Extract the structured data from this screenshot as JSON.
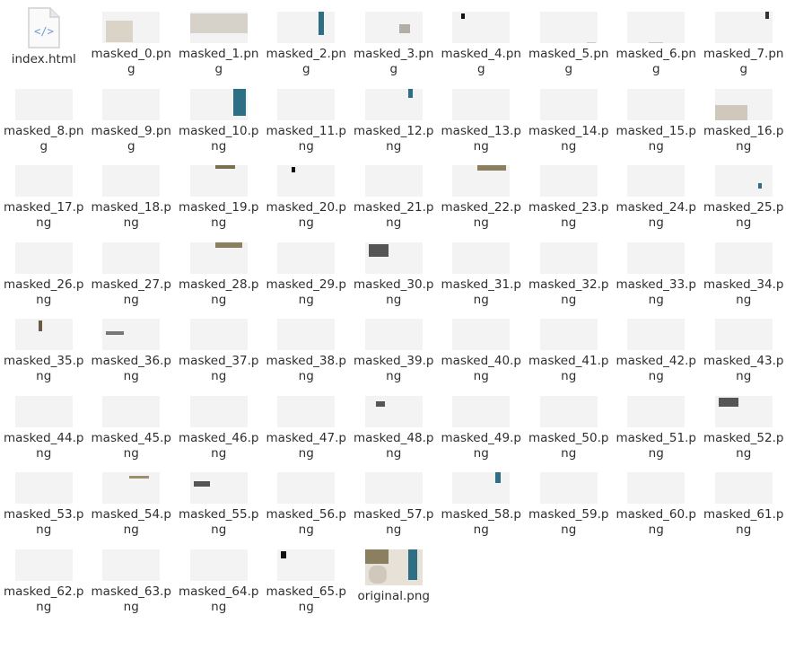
{
  "files": [
    {
      "name": "index.html",
      "type": "html",
      "icon": "html-file-icon"
    },
    {
      "name": "masked_0.png",
      "type": "png"
    },
    {
      "name": "masked_1.png",
      "type": "png"
    },
    {
      "name": "masked_2.png",
      "type": "png"
    },
    {
      "name": "masked_3.png",
      "type": "png"
    },
    {
      "name": "masked_4.png",
      "type": "png"
    },
    {
      "name": "masked_5.png",
      "type": "png"
    },
    {
      "name": "masked_6.png",
      "type": "png"
    },
    {
      "name": "masked_7.png",
      "type": "png"
    },
    {
      "name": "masked_8.png",
      "type": "png"
    },
    {
      "name": "masked_9.png",
      "type": "png"
    },
    {
      "name": "masked_10.png",
      "type": "png"
    },
    {
      "name": "masked_11.png",
      "type": "png"
    },
    {
      "name": "masked_12.png",
      "type": "png"
    },
    {
      "name": "masked_13.png",
      "type": "png"
    },
    {
      "name": "masked_14.png",
      "type": "png"
    },
    {
      "name": "masked_15.png",
      "type": "png"
    },
    {
      "name": "masked_16.png",
      "type": "png"
    },
    {
      "name": "masked_17.png",
      "type": "png"
    },
    {
      "name": "masked_18.png",
      "type": "png"
    },
    {
      "name": "masked_19.png",
      "type": "png"
    },
    {
      "name": "masked_20.png",
      "type": "png"
    },
    {
      "name": "masked_21.png",
      "type": "png"
    },
    {
      "name": "masked_22.png",
      "type": "png"
    },
    {
      "name": "masked_23.png",
      "type": "png"
    },
    {
      "name": "masked_24.png",
      "type": "png"
    },
    {
      "name": "masked_25.png",
      "type": "png"
    },
    {
      "name": "masked_26.png",
      "type": "png"
    },
    {
      "name": "masked_27.png",
      "type": "png"
    },
    {
      "name": "masked_28.png",
      "type": "png"
    },
    {
      "name": "masked_29.png",
      "type": "png"
    },
    {
      "name": "masked_30.png",
      "type": "png"
    },
    {
      "name": "masked_31.png",
      "type": "png"
    },
    {
      "name": "masked_32.png",
      "type": "png"
    },
    {
      "name": "masked_33.png",
      "type": "png"
    },
    {
      "name": "masked_34.png",
      "type": "png"
    },
    {
      "name": "masked_35.png",
      "type": "png"
    },
    {
      "name": "masked_36.png",
      "type": "png"
    },
    {
      "name": "masked_37.png",
      "type": "png"
    },
    {
      "name": "masked_38.png",
      "type": "png"
    },
    {
      "name": "masked_39.png",
      "type": "png"
    },
    {
      "name": "masked_40.png",
      "type": "png"
    },
    {
      "name": "masked_41.png",
      "type": "png"
    },
    {
      "name": "masked_42.png",
      "type": "png"
    },
    {
      "name": "masked_43.png",
      "type": "png"
    },
    {
      "name": "masked_44.png",
      "type": "png"
    },
    {
      "name": "masked_45.png",
      "type": "png"
    },
    {
      "name": "masked_46.png",
      "type": "png"
    },
    {
      "name": "masked_47.png",
      "type": "png"
    },
    {
      "name": "masked_48.png",
      "type": "png"
    },
    {
      "name": "masked_49.png",
      "type": "png"
    },
    {
      "name": "masked_50.png",
      "type": "png"
    },
    {
      "name": "masked_51.png",
      "type": "png"
    },
    {
      "name": "masked_52.png",
      "type": "png"
    },
    {
      "name": "masked_53.png",
      "type": "png"
    },
    {
      "name": "masked_54.png",
      "type": "png"
    },
    {
      "name": "masked_55.png",
      "type": "png"
    },
    {
      "name": "masked_56.png",
      "type": "png"
    },
    {
      "name": "masked_57.png",
      "type": "png"
    },
    {
      "name": "masked_58.png",
      "type": "png"
    },
    {
      "name": "masked_59.png",
      "type": "png"
    },
    {
      "name": "masked_60.png",
      "type": "png"
    },
    {
      "name": "masked_61.png",
      "type": "png"
    },
    {
      "name": "masked_62.png",
      "type": "png"
    },
    {
      "name": "masked_63.png",
      "type": "png"
    },
    {
      "name": "masked_64.png",
      "type": "png"
    },
    {
      "name": "masked_65.png",
      "type": "png"
    },
    {
      "name": "original.png",
      "type": "png"
    }
  ],
  "colors": {
    "thumb_bg": "#f3f3f3",
    "label_text": "#2f2f2f",
    "html_icon_accent": "#6f98d6"
  }
}
